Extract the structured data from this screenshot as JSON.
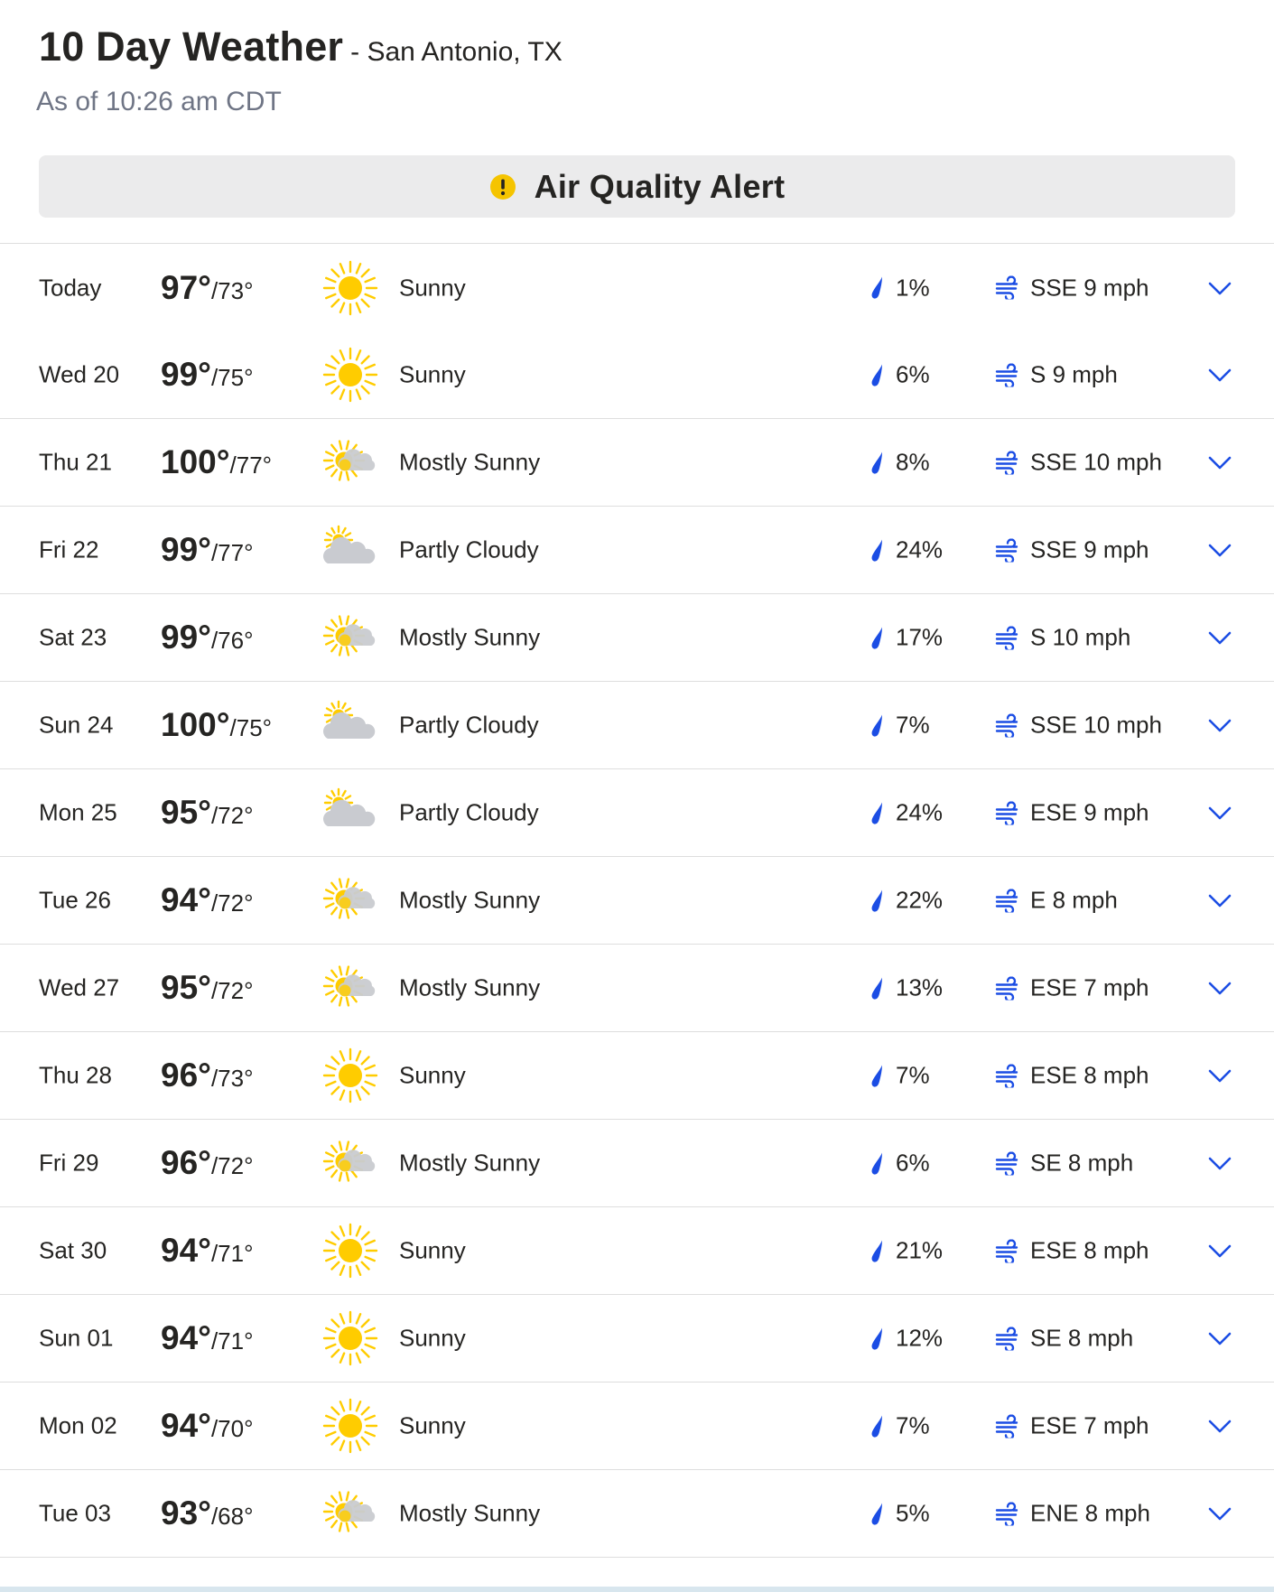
{
  "header": {
    "title": "10 Day Weather",
    "location": "- San Antonio, TX",
    "timestamp": "As of 10:26 am CDT"
  },
  "alert": {
    "label": "Air Quality Alert",
    "icon": "alert-circle-icon",
    "color": "#f5c400"
  },
  "colors": {
    "accent": "#1b4de4",
    "sun": "#ffcc00",
    "cloud": "#c9cbd0",
    "divider": "#dedede"
  },
  "days": [
    {
      "day": "Today",
      "hi": "97°",
      "lo": "/73°",
      "phrase": "Sunny",
      "icon": "sunny-icon",
      "precip": "1%",
      "wind": "SSE 9 mph"
    },
    {
      "day": "Wed 20",
      "hi": "99°",
      "lo": "/75°",
      "phrase": "Sunny",
      "icon": "sunny-icon",
      "precip": "6%",
      "wind": "S 9 mph"
    },
    {
      "day": "Thu 21",
      "hi": "100°",
      "lo": "/77°",
      "phrase": "Mostly Sunny",
      "icon": "mostly-sunny-icon",
      "precip": "8%",
      "wind": "SSE 10 mph"
    },
    {
      "day": "Fri 22",
      "hi": "99°",
      "lo": "/77°",
      "phrase": "Partly Cloudy",
      "icon": "partly-cloudy-icon",
      "precip": "24%",
      "wind": "SSE 9 mph"
    },
    {
      "day": "Sat 23",
      "hi": "99°",
      "lo": "/76°",
      "phrase": "Mostly Sunny",
      "icon": "mostly-sunny-icon",
      "precip": "17%",
      "wind": "S 10 mph"
    },
    {
      "day": "Sun 24",
      "hi": "100°",
      "lo": "/75°",
      "phrase": "Partly Cloudy",
      "icon": "partly-cloudy-icon",
      "precip": "7%",
      "wind": "SSE 10 mph"
    },
    {
      "day": "Mon 25",
      "hi": "95°",
      "lo": "/72°",
      "phrase": "Partly Cloudy",
      "icon": "partly-cloudy-icon",
      "precip": "24%",
      "wind": "ESE 9 mph"
    },
    {
      "day": "Tue 26",
      "hi": "94°",
      "lo": "/72°",
      "phrase": "Mostly Sunny",
      "icon": "mostly-sunny-icon",
      "precip": "22%",
      "wind": "E 8 mph"
    },
    {
      "day": "Wed 27",
      "hi": "95°",
      "lo": "/72°",
      "phrase": "Mostly Sunny",
      "icon": "mostly-sunny-icon",
      "precip": "13%",
      "wind": "ESE 7 mph"
    },
    {
      "day": "Thu 28",
      "hi": "96°",
      "lo": "/73°",
      "phrase": "Sunny",
      "icon": "sunny-icon",
      "precip": "7%",
      "wind": "ESE 8 mph"
    },
    {
      "day": "Fri 29",
      "hi": "96°",
      "lo": "/72°",
      "phrase": "Mostly Sunny",
      "icon": "mostly-sunny-icon",
      "precip": "6%",
      "wind": "SE 8 mph"
    },
    {
      "day": "Sat 30",
      "hi": "94°",
      "lo": "/71°",
      "phrase": "Sunny",
      "icon": "sunny-icon",
      "precip": "21%",
      "wind": "ESE 8 mph"
    },
    {
      "day": "Sun 01",
      "hi": "94°",
      "lo": "/71°",
      "phrase": "Sunny",
      "icon": "sunny-icon",
      "precip": "12%",
      "wind": "SE 8 mph"
    },
    {
      "day": "Mon 02",
      "hi": "94°",
      "lo": "/70°",
      "phrase": "Sunny",
      "icon": "sunny-icon",
      "precip": "7%",
      "wind": "ESE 7 mph"
    },
    {
      "day": "Tue 03",
      "hi": "93°",
      "lo": "/68°",
      "phrase": "Mostly Sunny",
      "icon": "mostly-sunny-icon",
      "precip": "5%",
      "wind": "ENE 8 mph"
    }
  ]
}
